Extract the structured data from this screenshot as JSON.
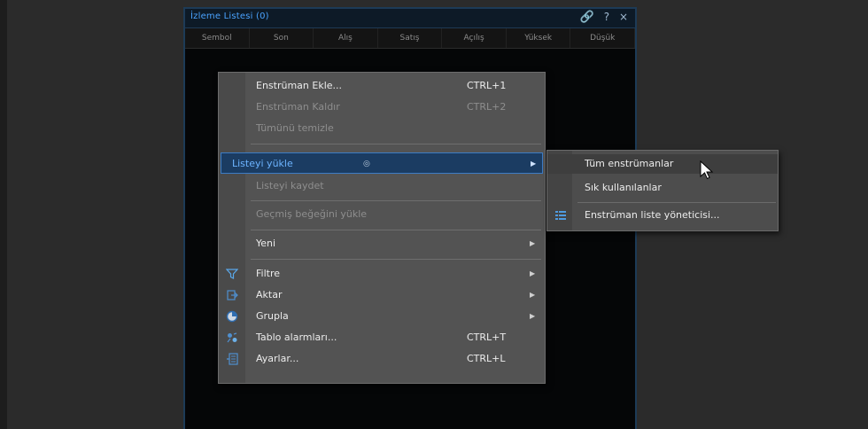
{
  "watchlist": {
    "title": "İzleme Listesi (0)",
    "columns": [
      "Sembol",
      "Son",
      "Alış",
      "Satış",
      "Açılış",
      "Yüksek",
      "Düşük"
    ],
    "icons": {
      "link": "link-icon",
      "help": "?",
      "close": "×"
    }
  },
  "menu": {
    "items": [
      {
        "label": "Enstrüman Ekle...",
        "shortcut": "CTRL+1",
        "enabled": true
      },
      {
        "label": "Enstrüman Kaldır",
        "shortcut": "CTRL+2",
        "enabled": false
      },
      {
        "label": "Tümünü temizle",
        "enabled": false
      },
      {
        "label": "Listeyi yükle",
        "submenu": true,
        "highlighted": true
      },
      {
        "label": "Listeyi kaydet",
        "enabled": false
      },
      {
        "label": "Geçmiş beğeğini yükle",
        "enabled": false
      },
      {
        "label": "Yeni",
        "submenu": true
      },
      {
        "label": "Filtre",
        "submenu": true,
        "icon": "filter-icon"
      },
      {
        "label": "Aktar",
        "submenu": true,
        "icon": "export-icon"
      },
      {
        "label": "Grupla",
        "submenu": true,
        "icon": "group-icon"
      },
      {
        "label": "Tablo alarmları...",
        "shortcut": "CTRL+T",
        "icon": "alarm-icon"
      },
      {
        "label": "Ayarlar...",
        "shortcut": "CTRL+L",
        "icon": "settings-icon"
      }
    ]
  },
  "submenu": {
    "items": [
      {
        "label": "Tüm enstrümanlar",
        "selected": true
      },
      {
        "label": "Sık kullanılanlar"
      },
      {
        "label": "Enstrüman liste yöneticisi...",
        "icon": "list-manager-icon"
      }
    ]
  },
  "colors": {
    "accent": "#4aa3ff",
    "highlight": "#1b3c62",
    "menu_bg": "#535353"
  }
}
